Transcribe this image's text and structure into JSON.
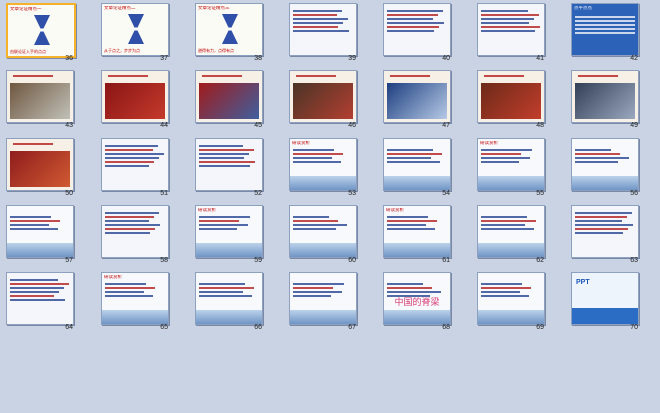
{
  "slides": [
    {
      "num": "36",
      "title": "文章论证精点一",
      "subtitle": "由联论证入手的点点"
    },
    {
      "num": "37",
      "title": "文章论证精点二",
      "subtitle": "从于点之，步步为点"
    },
    {
      "num": "38",
      "title": "文章论证精点三",
      "subtitle": "避得有力，点得有点"
    },
    {
      "num": "39",
      "title": "",
      "subtitle": ""
    },
    {
      "num": "40",
      "title": "",
      "subtitle": ""
    },
    {
      "num": "41",
      "title": "",
      "subtitle": ""
    },
    {
      "num": "42",
      "title": "点平点点",
      "subtitle": ""
    },
    {
      "num": "43",
      "title": "",
      "subtitle": ""
    },
    {
      "num": "44",
      "title": "",
      "subtitle": ""
    },
    {
      "num": "45",
      "title": "",
      "subtitle": ""
    },
    {
      "num": "46",
      "title": "",
      "subtitle": ""
    },
    {
      "num": "47",
      "title": "",
      "subtitle": ""
    },
    {
      "num": "48",
      "title": "",
      "subtitle": ""
    },
    {
      "num": "49",
      "title": "",
      "subtitle": ""
    },
    {
      "num": "50",
      "title": "",
      "subtitle": ""
    },
    {
      "num": "51",
      "title": "",
      "subtitle": ""
    },
    {
      "num": "52",
      "title": "",
      "subtitle": ""
    },
    {
      "num": "53",
      "title": "研读赏析",
      "subtitle": ""
    },
    {
      "num": "54",
      "title": "",
      "subtitle": ""
    },
    {
      "num": "55",
      "title": "研读赏析",
      "subtitle": ""
    },
    {
      "num": "56",
      "title": "",
      "subtitle": ""
    },
    {
      "num": "57",
      "title": "",
      "subtitle": ""
    },
    {
      "num": "58",
      "title": "",
      "subtitle": ""
    },
    {
      "num": "59",
      "title": "研读赏析",
      "subtitle": ""
    },
    {
      "num": "60",
      "title": "",
      "subtitle": ""
    },
    {
      "num": "61",
      "title": "研读赏析",
      "subtitle": ""
    },
    {
      "num": "62",
      "title": "",
      "subtitle": ""
    },
    {
      "num": "63",
      "title": "",
      "subtitle": ""
    },
    {
      "num": "64",
      "title": "",
      "subtitle": ""
    },
    {
      "num": "65",
      "title": "研读赏析",
      "subtitle": ""
    },
    {
      "num": "66",
      "title": "",
      "subtitle": ""
    },
    {
      "num": "67",
      "title": "",
      "subtitle": ""
    },
    {
      "num": "68",
      "title": "",
      "subtitle": "中国的脊梁"
    },
    {
      "num": "69",
      "title": "",
      "subtitle": ""
    },
    {
      "num": "70",
      "title": "PPT",
      "subtitle": ""
    }
  ]
}
